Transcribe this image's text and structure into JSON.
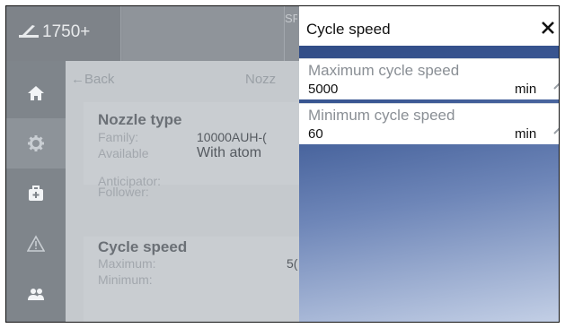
{
  "header": {
    "app_label": "1750+",
    "stub_text": "SR"
  },
  "nav": {
    "items": [
      {
        "name": "home",
        "icon": "home-icon"
      },
      {
        "name": "settings",
        "icon": "gear-icon"
      },
      {
        "name": "maintenance",
        "icon": "first-aid-icon"
      },
      {
        "name": "alarms",
        "icon": "warning-icon"
      },
      {
        "name": "users",
        "icon": "users-icon"
      }
    ],
    "active": "settings"
  },
  "main": {
    "back_label": "Back",
    "crumb_label": "Nozz",
    "nozzle": {
      "title": "Nozzle type",
      "family_label": "Family:",
      "family_value": "10000AUH-(",
      "available_label": "Available",
      "available_value": "With atom",
      "anticipator_label": "Anticipator:",
      "follower_label": "Follower:"
    },
    "cycle": {
      "title": "Cycle speed",
      "maximum_label": "Maximum:",
      "maximum_value": "5(",
      "minimum_label": "Minimum:"
    }
  },
  "panel": {
    "title": "Cycle speed",
    "fields": [
      {
        "label": "Maximum cycle speed",
        "value": "5000",
        "unit": "min"
      },
      {
        "label": "Minimum cycle speed",
        "value": "60",
        "unit": "min"
      }
    ]
  },
  "colors": {
    "panel_gradient_top": "#2c4780",
    "panel_gradient_bottom": "#c4d0e6",
    "nav_bg": "#7f858b"
  }
}
